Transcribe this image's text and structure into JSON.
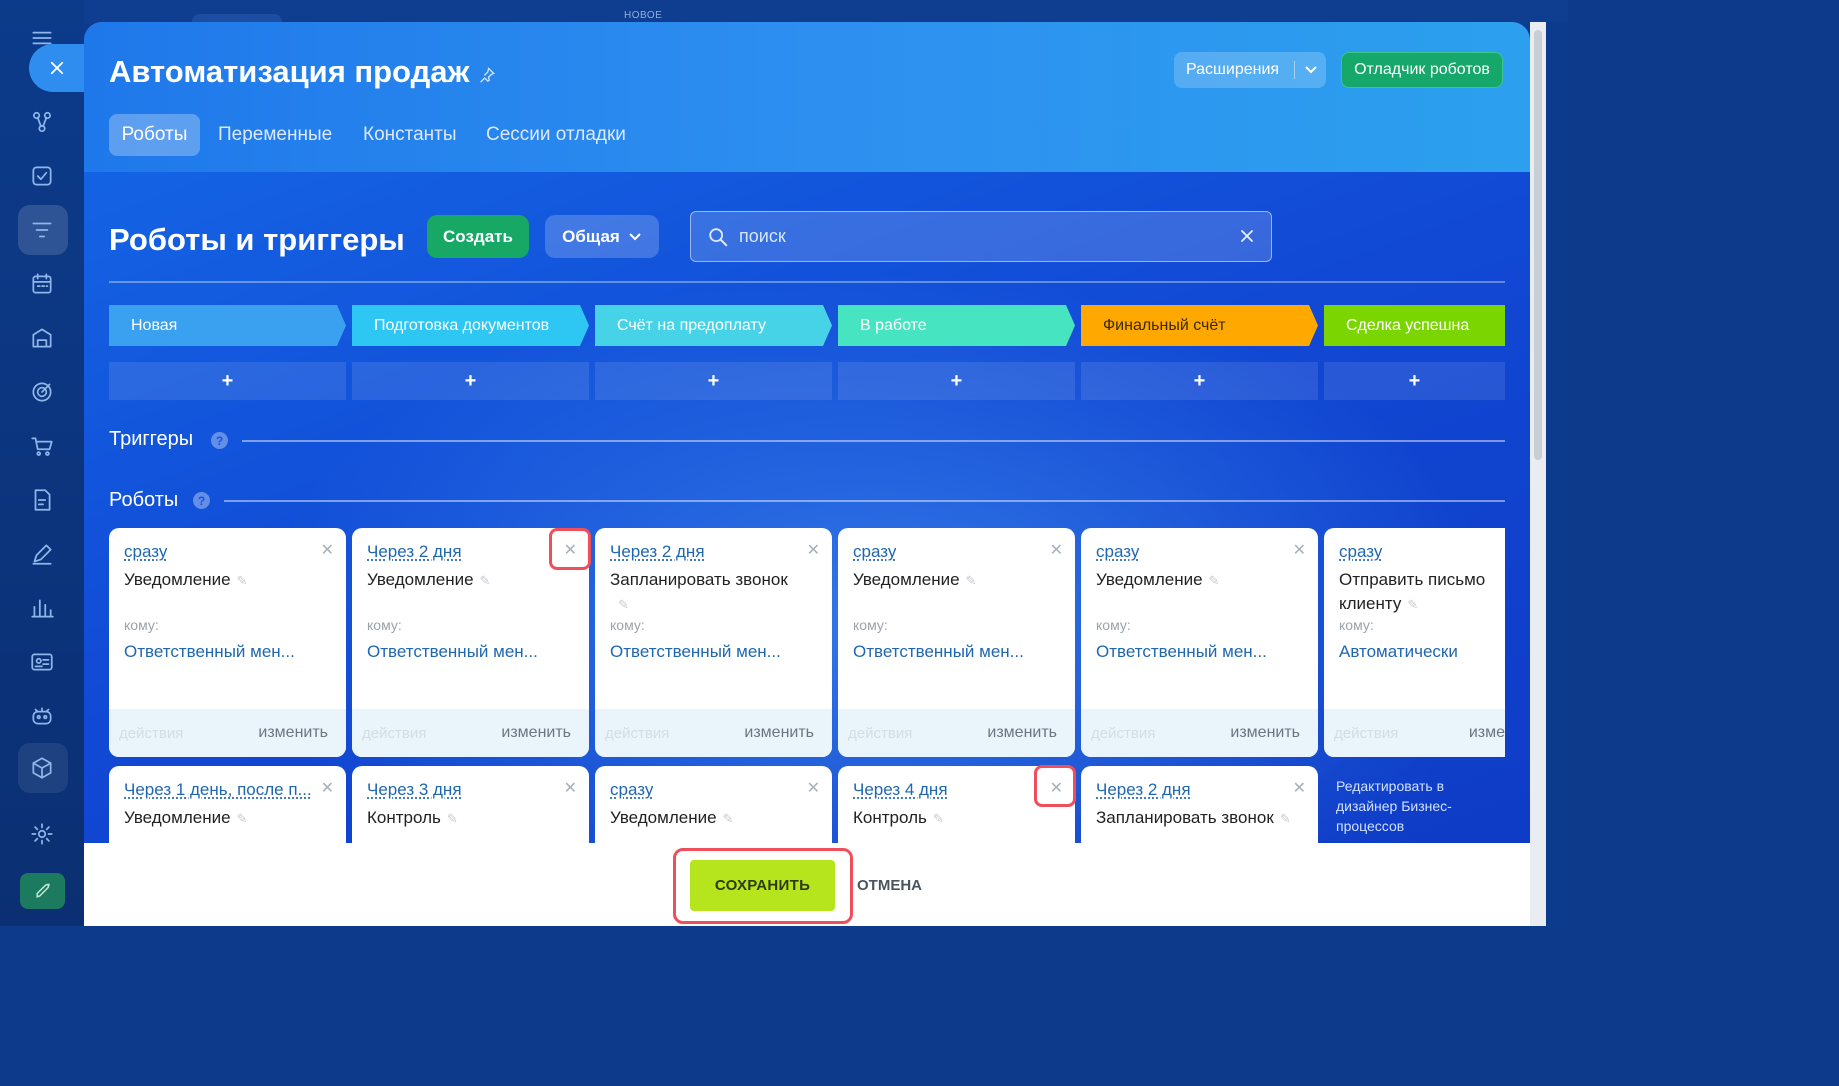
{
  "top": {
    "new_tab_label": "НОВОЕ"
  },
  "header": {
    "title": "Автоматизация продаж",
    "extensions_label": "Расширения",
    "debugger_label": "Отладчик роботов",
    "tabs": [
      {
        "label": "Роботы",
        "active": true
      },
      {
        "label": "Переменные"
      },
      {
        "label": "Константы"
      },
      {
        "label": "Сессии отладки"
      }
    ]
  },
  "toolbar": {
    "section_title": "Роботы и триггеры",
    "create_label": "Создать",
    "general_label": "Общая",
    "search_placeholder": "поиск"
  },
  "stages": [
    {
      "label": "Новая",
      "color": "#3aa0f0"
    },
    {
      "label": "Подготовка документов",
      "color": "#2ec6f3"
    },
    {
      "label": "Счёт на предоплату",
      "color": "#47d3e7"
    },
    {
      "label": "В работе",
      "color": "#47e4c2"
    },
    {
      "label": "Финальный счёт",
      "color": "#ffa800"
    },
    {
      "label": "Сделка успешна",
      "color": "#7bd500"
    }
  ],
  "plus_label": "+",
  "triggers_label": "Триггеры",
  "robots_label": "Роботы",
  "help_label": "?",
  "cards_row1": [
    {
      "delay": "сразу",
      "name": "Уведомление",
      "to_label": "кому:",
      "to": "Ответственный мен...",
      "actions": "действия",
      "edit": "изменить"
    },
    {
      "delay": "Через 2 дня",
      "name": "Уведомление",
      "to_label": "кому:",
      "to": "Ответственный мен...",
      "actions": "действия",
      "edit": "изменить"
    },
    {
      "delay": "Через 2 дня",
      "name": "Запланировать звонок",
      "to_label": "кому:",
      "to": "Ответственный мен...",
      "actions": "действия",
      "edit": "изменить"
    },
    {
      "delay": "сразу",
      "name": "Уведомление",
      "to_label": "кому:",
      "to": "Ответственный мен...",
      "actions": "действия",
      "edit": "изменить"
    },
    {
      "delay": "сразу",
      "name": "Уведомление",
      "to_label": "кому:",
      "to": "Ответственный мен...",
      "actions": "действия",
      "edit": "изменить"
    },
    {
      "delay": "сразу",
      "name": "Отправить письмо клиенту",
      "to_label": "кому:",
      "to": "Автоматически",
      "actions": "действия",
      "edit": "изме"
    }
  ],
  "cards_row2": [
    {
      "delay": "Через 1 день, после п...",
      "name": "Уведомление"
    },
    {
      "delay": "Через 3 дня",
      "name": "Контроль"
    },
    {
      "delay": "сразу",
      "name": "Уведомление"
    },
    {
      "delay": "Через 4 дня",
      "name": "Контроль"
    },
    {
      "delay": "Через 2 дня",
      "name": "Запланировать звонок"
    }
  ],
  "bp_designer_link": "Редактировать в дизайнер Бизнес-процессов",
  "footer": {
    "save_label": "СОХРАНИТЬ",
    "cancel_label": "ОТМЕНА"
  }
}
